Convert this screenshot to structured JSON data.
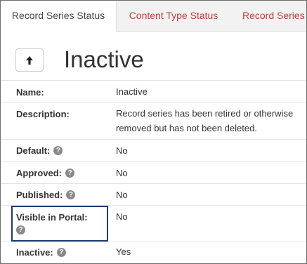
{
  "tabs": [
    {
      "label": "Record Series Status",
      "active": true
    },
    {
      "label": "Content Type Status",
      "active": false
    },
    {
      "label": "Record Series",
      "active": false
    }
  ],
  "header": {
    "back_icon": "arrow-up-icon",
    "title": "Inactive"
  },
  "details": {
    "name": {
      "label": "Name:",
      "value": "Inactive"
    },
    "description": {
      "label": "Description:",
      "value_line1": "Record series has been retired or otherwise",
      "value_line2": "removed but has not been deleted."
    },
    "default": {
      "label": "Default:",
      "value": "No"
    },
    "approved": {
      "label": "Approved:",
      "value": "No"
    },
    "published": {
      "label": "Published:",
      "value": "No"
    },
    "visible_in_portal": {
      "label": "Visible in Portal:",
      "value": "No"
    },
    "inactive": {
      "label": "Inactive:",
      "value": "Yes"
    }
  },
  "help_icon_glyph": "?",
  "colors": {
    "tab_link": "#b5413a",
    "highlight_border": "#1f3b73",
    "help_icon": "#8a8a8a"
  }
}
